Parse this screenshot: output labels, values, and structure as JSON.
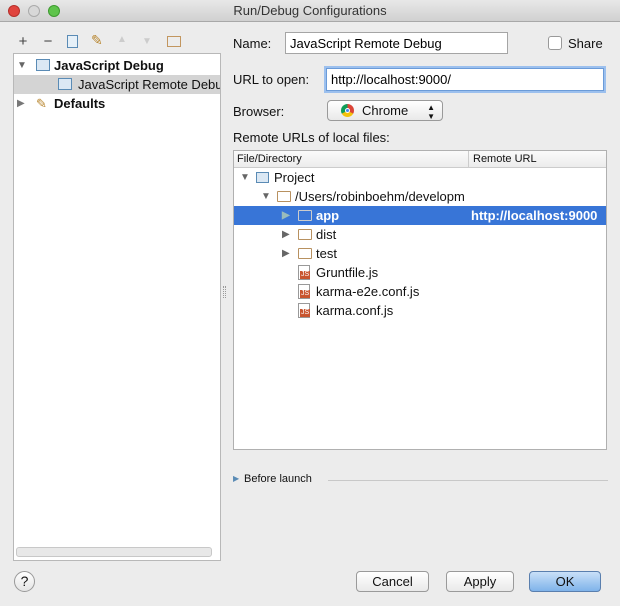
{
  "window": {
    "title": "Run/Debug Configurations"
  },
  "toolbar": {
    "add": "+",
    "remove": "−"
  },
  "tree": {
    "items": [
      {
        "label": "JavaScript Debug",
        "expanded": true
      },
      {
        "label": "JavaScript Remote Debug",
        "selected": true
      },
      {
        "label": "Defaults",
        "expanded": false
      }
    ]
  },
  "form": {
    "name_label": "Name:",
    "name_value": "JavaScript Remote Debug",
    "share_label": "Share",
    "share_checked": false,
    "url_label": "URL to open:",
    "url_value": "http://localhost:9000/",
    "browser_label": "Browser:",
    "browser_value": "Chrome",
    "remote_urls_label": "Remote URLs of local files:"
  },
  "table": {
    "columns": [
      "File/Directory",
      "Remote URL"
    ],
    "rows": [
      {
        "name": "Project",
        "url": ""
      },
      {
        "name": "/Users/robinboehm/developm",
        "url": ""
      },
      {
        "name": "app",
        "url": "http://localhost:9000",
        "selected": true
      },
      {
        "name": "dist",
        "url": ""
      },
      {
        "name": "test",
        "url": ""
      },
      {
        "name": "Gruntfile.js",
        "url": ""
      },
      {
        "name": "karma-e2e.conf.js",
        "url": ""
      },
      {
        "name": "karma.conf.js",
        "url": ""
      }
    ]
  },
  "before_launch": "Before launch",
  "buttons": {
    "help": "?",
    "cancel": "Cancel",
    "apply": "Apply",
    "ok": "OK"
  },
  "colors": {
    "selection": "#3875d7",
    "ok": "#7fb3ea"
  }
}
